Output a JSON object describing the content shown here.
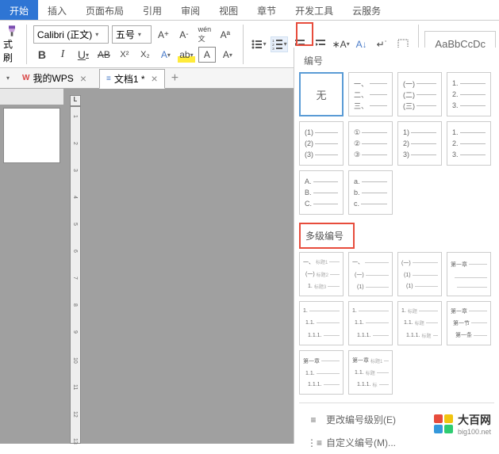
{
  "tabs": [
    "开始",
    "插入",
    "页面布局",
    "引用",
    "审阅",
    "视图",
    "章节",
    "开发工具",
    "云服务"
  ],
  "active_tab": 0,
  "font": {
    "name": "Calibri (正文)",
    "size": "五号"
  },
  "format_brush_label": "式刷",
  "style_preview": "AaBbCcDc",
  "doc_tabs": {
    "wps": "我的WPS",
    "doc": "文档1 *"
  },
  "numbering": {
    "label": "编号",
    "none": "无",
    "options": [
      [
        "一、",
        "二、",
        "三、"
      ],
      [
        "(一)",
        "(二)",
        "(三)"
      ],
      [
        "1.",
        "2.",
        "3."
      ],
      [
        "(1)",
        "(2)",
        "(3)"
      ],
      [
        "①",
        "②",
        "③"
      ],
      [
        "1)",
        "2)",
        "3)"
      ],
      [
        "1.",
        "2.",
        "3."
      ],
      [
        "A.",
        "B.",
        "C."
      ],
      [
        "a.",
        "b.",
        "c."
      ]
    ]
  },
  "multilevel": {
    "header": "多级编号",
    "options": [
      [
        [
          "一、",
          "标题1"
        ],
        [
          "(一)",
          "标题2"
        ],
        [
          "1.",
          "标题3"
        ]
      ],
      [
        [
          "一、",
          ""
        ],
        [
          "(一)",
          ""
        ],
        [
          "(1)",
          ""
        ]
      ],
      [
        [
          "(一)",
          ""
        ],
        [
          "(1)",
          ""
        ],
        [
          "(1)",
          ""
        ]
      ],
      [
        [
          "第一章",
          ""
        ],
        [
          "",
          ""
        ],
        [
          "",
          ""
        ]
      ],
      [
        [
          "1.",
          ""
        ],
        [
          "1.1.",
          ""
        ],
        [
          "1.1.1.",
          ""
        ]
      ],
      [
        [
          "1.",
          ""
        ],
        [
          "1.1.",
          ""
        ],
        [
          "1.1.1.",
          ""
        ]
      ],
      [
        [
          "1.",
          "标题"
        ],
        [
          "1.1.",
          "标题"
        ],
        [
          "1.1.1.",
          "标题"
        ]
      ],
      [
        [
          "第一章",
          ""
        ],
        [
          "第一节",
          ""
        ],
        [
          "第一条",
          ""
        ]
      ],
      [
        [
          "第一章",
          ""
        ],
        [
          "1.1.",
          ""
        ],
        [
          "1.1.1.",
          ""
        ]
      ],
      [
        [
          "第一章",
          "标题1"
        ],
        [
          "1.1.",
          "标题"
        ],
        [
          "1.1.1.",
          "标"
        ]
      ]
    ]
  },
  "menu": {
    "change_level": "更改编号级别(E)",
    "custom": "自定义编号(M)..."
  },
  "watermark": {
    "title": "大百网",
    "sub": "big100.net"
  },
  "ruler_ticks": [
    "1",
    "2",
    "3",
    "4",
    "5",
    "6",
    "7",
    "8",
    "9",
    "10",
    "11",
    "12",
    "13"
  ]
}
